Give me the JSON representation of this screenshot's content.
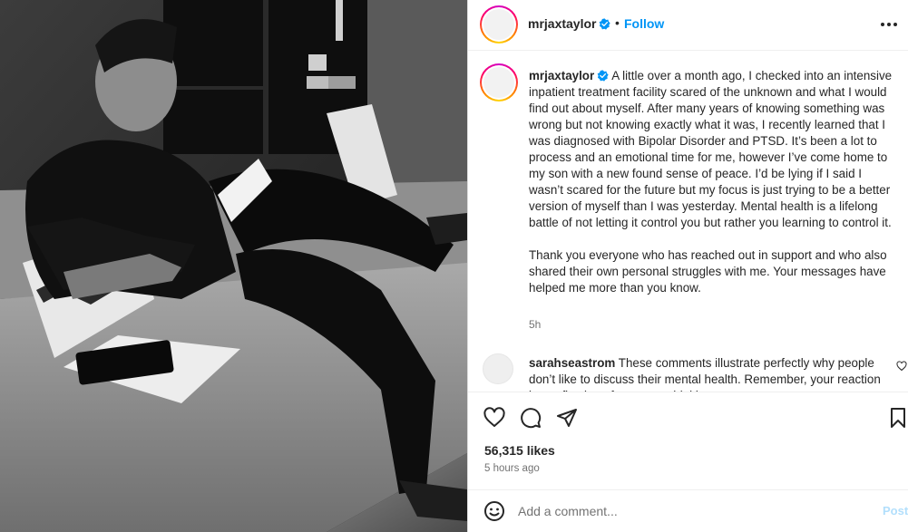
{
  "post": {
    "username": "mrjaxtaylor",
    "separator": "•",
    "follow_label": "Follow",
    "caption_paragraphs": [
      "A little over a month ago, I checked into an intensive inpatient treatment facility scared of the unknown and what I would find out about myself. After many years of knowing something was wrong but not knowing exactly what it was, I recently learned that I was diagnosed with Bipolar Disorder and PTSD. It’s been a lot to process and an emotional time for me, however I’ve come home to my son with a new found sense of peace. I’d be lying if I said I wasn’t scared for the future but my focus is just trying to be a better version of myself than I was yesterday. Mental health is a lifelong battle of not letting it control you but rather you learning to control it.",
      "Thank you everyone who has reached out in support and who also shared their own personal struggles with me. Your messages have helped me more than you know."
    ],
    "caption_time": "5h",
    "likes": "56,315 likes",
    "time_ago": "5 hours ago"
  },
  "comments": [
    {
      "username": "sarahseastrom",
      "text": "These comments illustrate perfectly why people don’t like to discuss their mental health. Remember, your reaction is a reflection of your own thinking..."
    }
  ],
  "composer": {
    "placeholder": "Add a comment...",
    "post_label": "Post"
  },
  "colors": {
    "accent": "#0095f6",
    "post_disabled": "#b2dffc",
    "verified": "#0095f6",
    "muted": "#737373"
  },
  "icons": [
    "verified-badge-icon",
    "more-options-icon",
    "heart-icon",
    "comment-icon",
    "share-icon",
    "bookmark-icon",
    "emoji-icon",
    "small-heart-icon"
  ]
}
